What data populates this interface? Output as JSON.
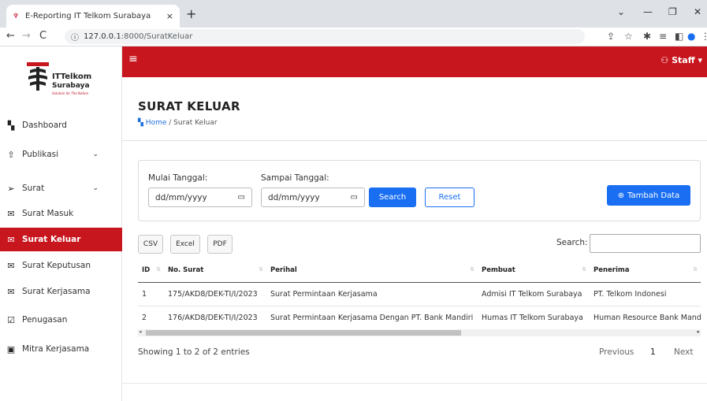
{
  "browser": {
    "tab_title": "E-Reporting IT Telkom Surabaya",
    "tab_close": "×",
    "new_tab": "+",
    "url_host": "127.0.0.1",
    "url_path": ":8000/SuratKeluar",
    "url_info": "ⓘ",
    "nav_back": "←",
    "nav_forward": "→",
    "nav_reload": "C",
    "win_min": "—",
    "win_max": "❐",
    "win_close": "✕",
    "win_collapse": "⌄"
  },
  "logo": {
    "name_line1": "ITTelkom",
    "name_line2": "Surabaya",
    "tagline": "Solution for The Nation"
  },
  "sidebar": {
    "items": [
      {
        "label": "Dashboard",
        "icon": "▚",
        "icon_name": "dashboard-icon",
        "name": "sidebar-item-dashboard"
      },
      {
        "label": "Publikasi",
        "icon": "⇧",
        "icon_name": "upload-icon",
        "name": "sidebar-item-publikasi",
        "chevron": "⌄"
      },
      {
        "label": "Surat",
        "icon": "➢",
        "icon_name": "send-icon",
        "name": "sidebar-item-surat",
        "chevron": "⌄"
      },
      {
        "label": "Surat Masuk",
        "icon": "✉",
        "icon_name": "mail-icon",
        "name": "sidebar-item-surat-masuk"
      },
      {
        "label": "Surat Keluar",
        "icon": "✉",
        "icon_name": "mail-out-icon",
        "name": "sidebar-item-surat-keluar"
      },
      {
        "label": "Surat Keputusan",
        "icon": "✉",
        "icon_name": "mail-open-icon",
        "name": "sidebar-item-surat-keputusan"
      },
      {
        "label": "Surat Kerjasama",
        "icon": "✉",
        "icon_name": "mail-icon",
        "name": "sidebar-item-surat-kerjasama"
      },
      {
        "label": "Penugasan",
        "icon": "☑",
        "icon_name": "clipboard-check-icon",
        "name": "sidebar-item-penugasan"
      },
      {
        "label": "Mitra Kerjasama",
        "icon": "▣",
        "icon_name": "id-card-icon",
        "name": "sidebar-item-mitra-kerjasama"
      }
    ],
    "active": "Surat Keluar"
  },
  "header": {
    "menu_icon": "≡",
    "user_label": "Staff",
    "user_icon": "⚇",
    "caret": "▾"
  },
  "page": {
    "title": "SURAT KELUAR",
    "breadcrumb_icon": "▚",
    "breadcrumb_home": "Home",
    "breadcrumb_sep": "/",
    "breadcrumb_current": "Surat Keluar"
  },
  "filter": {
    "start_label": "Mulai Tanggal:",
    "end_label": "Sampai Tanggal:",
    "start_placeholder": "dd/mm/yyyy",
    "end_placeholder": "dd/mm/yyyy",
    "calendar_icon": "▭",
    "search_button": "Search",
    "reset_button": "Reset",
    "add_button": "Tambah Data",
    "add_icon": "⊕"
  },
  "table_tools": {
    "csv": "CSV",
    "excel": "Excel",
    "pdf": "PDF",
    "search_label": "Search:"
  },
  "table": {
    "columns": [
      "ID",
      "No. Surat",
      "Perihal",
      "Pembuat",
      "Penerima"
    ],
    "sort_glyph": "⇅",
    "rows": [
      [
        "1",
        "175/AKD8/DEK-TI/I/2023",
        "Surat Permintaan Kerjasama",
        "Admisi IT Telkom Surabaya",
        "PT. Telkom Indonesi"
      ],
      [
        "2",
        "176/AKD8/DEK-TI/I/2023",
        "Surat Permintaan Kerjasama Dengan PT. Bank Mandiri",
        "Humas IT Telkom Surabaya",
        "Human Resource Bank Mandi"
      ]
    ]
  },
  "pagination": {
    "info": "Showing 1 to 2 of 2 entries",
    "previous": "Previous",
    "page": "1",
    "next": "Next"
  },
  "colors": {
    "brand_red": "#c8161e",
    "primary_blue": "#1a6ef2"
  }
}
